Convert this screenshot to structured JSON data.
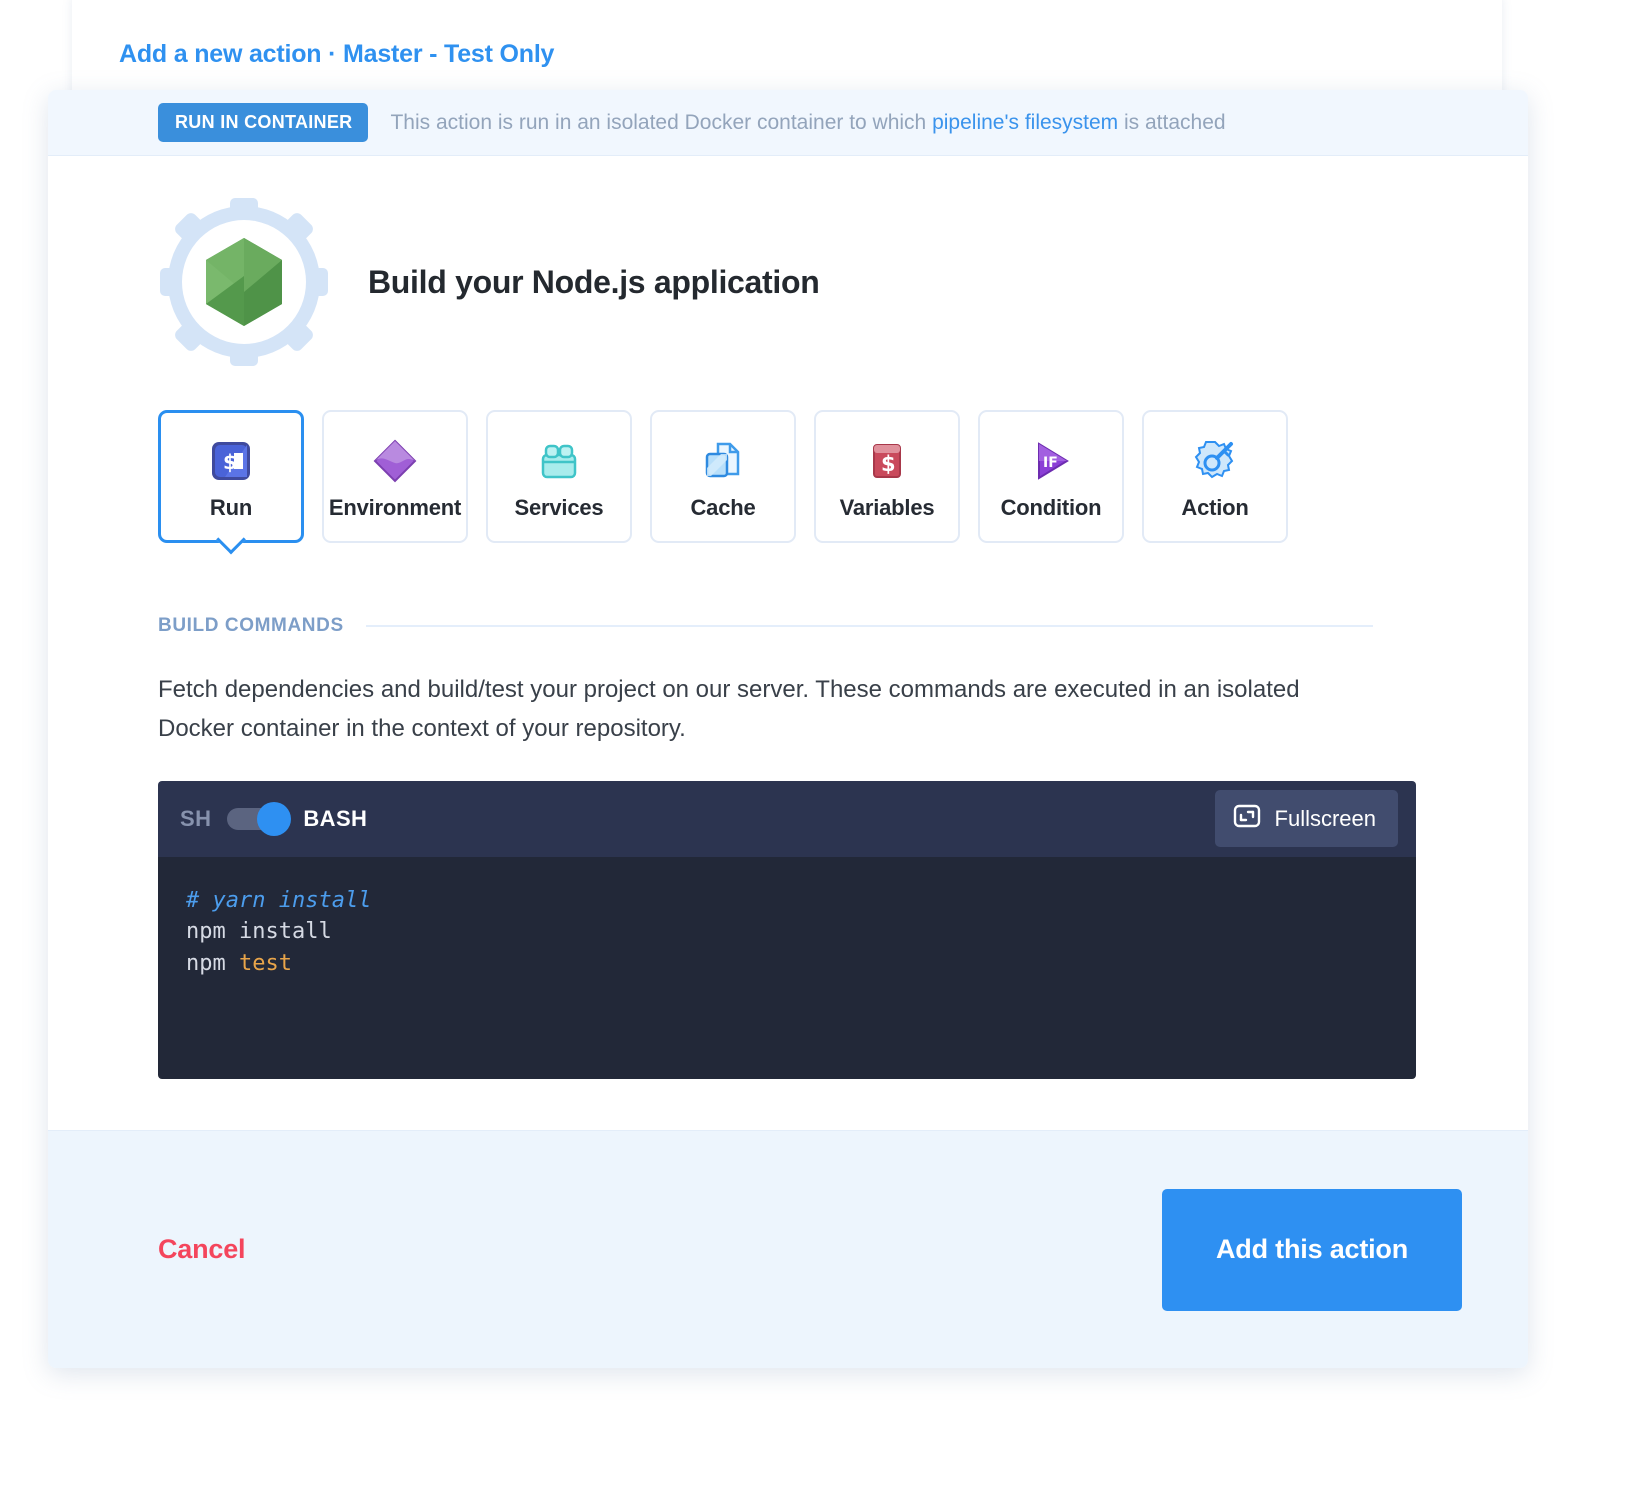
{
  "breadcrumb": {
    "text": "Add a new action · Master - Test Only"
  },
  "banner": {
    "badge": "RUN IN CONTAINER",
    "text_before": "This action is run in an isolated Docker container to which ",
    "link": "pipeline's filesystem",
    "text_after": " is attached"
  },
  "hero": {
    "title": "Build your Node.js application",
    "logo_icon": "nodejs-hexagon-gear-icon"
  },
  "tabs": [
    {
      "label": "Run",
      "icon": "terminal-prompt-icon",
      "selected": true
    },
    {
      "label": "Environment",
      "icon": "purple-diamond-icon",
      "selected": false
    },
    {
      "label": "Services",
      "icon": "cyan-crate-icon",
      "selected": false
    },
    {
      "label": "Cache",
      "icon": "blue-files-icon",
      "selected": false
    },
    {
      "label": "Variables",
      "icon": "red-dollar-box-icon",
      "selected": false
    },
    {
      "label": "Condition",
      "icon": "purple-if-play-icon",
      "selected": false
    },
    {
      "label": "Action",
      "icon": "blue-badge-key-icon",
      "selected": false
    }
  ],
  "section": {
    "heading": "BUILD COMMANDS",
    "description": "Fetch dependencies and build/test your project on our server. These commands are executed in an isolated Docker container in the context of your repository."
  },
  "editor": {
    "shell_left_label": "SH",
    "shell_right_label": "BASH",
    "toggle_state": "BASH",
    "fullscreen_label": "Fullscreen",
    "fullscreen_icon": "expand-icon",
    "lines": [
      {
        "comment": "# yarn install"
      },
      {
        "plain": "npm install"
      },
      {
        "plain": "npm ",
        "keyword": "test"
      }
    ]
  },
  "footer": {
    "cancel_label": "Cancel",
    "submit_label": "Add this action"
  },
  "colors": {
    "accent_blue": "#2e90f2",
    "badge_blue": "#3a8fdc",
    "cancel_red": "#f4455c",
    "editor_header": "#2c3450",
    "editor_body": "#222838",
    "footer_bg": "#edf5fd"
  }
}
